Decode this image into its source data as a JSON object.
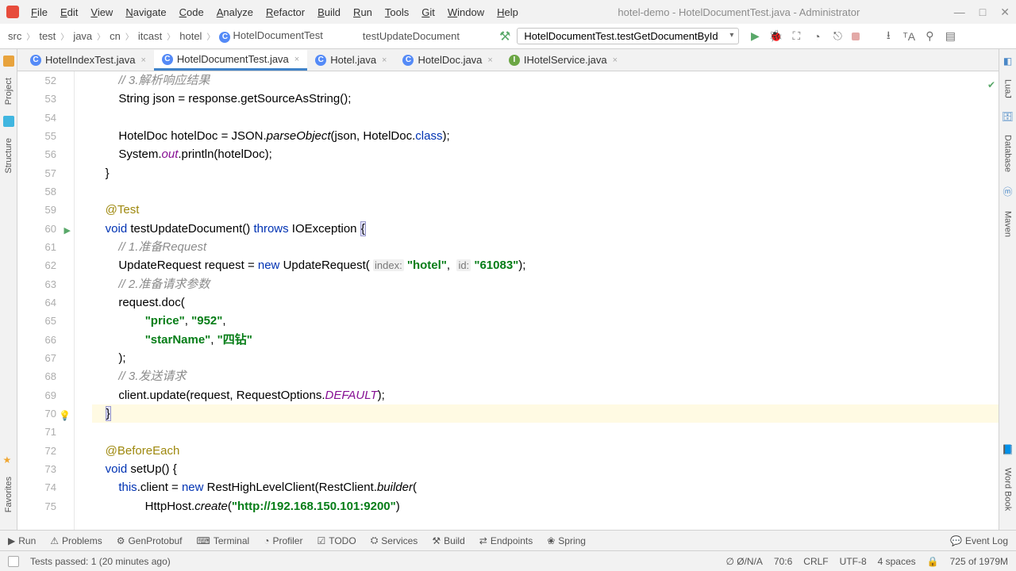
{
  "title": "hotel-demo - HotelDocumentTest.java - Administrator",
  "menu": [
    "File",
    "Edit",
    "View",
    "Navigate",
    "Code",
    "Analyze",
    "Refactor",
    "Build",
    "Run",
    "Tools",
    "Git",
    "Window",
    "Help"
  ],
  "breadcrumbs": [
    "src",
    "test",
    "java",
    "cn",
    "itcast",
    "hotel",
    "HotelDocumentTest",
    "testUpdateDocument"
  ],
  "run_config": "HotelDocumentTest.testGetDocumentById",
  "tabs": [
    {
      "icon": "c",
      "label": "HotelIndexTest.java",
      "active": false
    },
    {
      "icon": "c",
      "label": "HotelDocumentTest.java",
      "active": true
    },
    {
      "icon": "c",
      "label": "Hotel.java",
      "active": false
    },
    {
      "icon": "c",
      "label": "HotelDoc.java",
      "active": false
    },
    {
      "icon": "i",
      "label": "IHotelService.java",
      "active": false
    }
  ],
  "left_tools": [
    "Project",
    "Structure",
    "Favorites"
  ],
  "right_tools": [
    "LuaJ",
    "Database",
    "Maven",
    "Word Book"
  ],
  "bottom_tools": [
    "Run",
    "Problems",
    "GenProtobuf",
    "Terminal",
    "Profiler",
    "TODO",
    "Services",
    "Build",
    "Endpoints",
    "Spring"
  ],
  "event_log": "Event Log",
  "status": {
    "tests": "Tests passed: 1 (20 minutes ago)",
    "gc": "∅ Ø/N/A",
    "pos": "70:6",
    "eol": "CRLF",
    "enc": "UTF-8",
    "indent": "4 spaces",
    "mem": "725 of 1979M"
  },
  "gutter_start": 52,
  "code": [
    {
      "n": 52,
      "seg": [
        {
          "t": "        ",
          "c": ""
        },
        {
          "t": "// 3.解析响应结果",
          "c": "cmt"
        }
      ]
    },
    {
      "n": 53,
      "seg": [
        {
          "t": "        String json = response.getSourceAsString();",
          "c": ""
        }
      ]
    },
    {
      "n": 54,
      "seg": [
        {
          "t": "",
          "c": ""
        }
      ]
    },
    {
      "n": 55,
      "seg": [
        {
          "t": "        HotelDoc hotelDoc = JSON.",
          "c": ""
        },
        {
          "t": "parseObject",
          "c": "call"
        },
        {
          "t": "(json, HotelDoc.",
          "c": ""
        },
        {
          "t": "class",
          "c": "kw"
        },
        {
          "t": ");",
          "c": ""
        }
      ]
    },
    {
      "n": 56,
      "seg": [
        {
          "t": "        System.",
          "c": ""
        },
        {
          "t": "out",
          "c": "fld"
        },
        {
          "t": ".println(hotelDoc);",
          "c": ""
        }
      ]
    },
    {
      "n": 57,
      "seg": [
        {
          "t": "    }",
          "c": ""
        }
      ]
    },
    {
      "n": 58,
      "seg": [
        {
          "t": "",
          "c": ""
        }
      ]
    },
    {
      "n": 59,
      "seg": [
        {
          "t": "    ",
          "c": ""
        },
        {
          "t": "@Test",
          "c": "ann"
        }
      ]
    },
    {
      "n": 60,
      "run": true,
      "seg": [
        {
          "t": "    ",
          "c": ""
        },
        {
          "t": "void",
          "c": "kw"
        },
        {
          "t": " testUpdateDocument() ",
          "c": ""
        },
        {
          "t": "throws",
          "c": "kw"
        },
        {
          "t": " IOException ",
          "c": ""
        },
        {
          "t": "{",
          "c": "brace-hl"
        }
      ]
    },
    {
      "n": 61,
      "seg": [
        {
          "t": "        ",
          "c": ""
        },
        {
          "t": "// 1.准备Request",
          "c": "cmt"
        }
      ]
    },
    {
      "n": 62,
      "seg": [
        {
          "t": "        UpdateRequest request = ",
          "c": ""
        },
        {
          "t": "new",
          "c": "kw"
        },
        {
          "t": " UpdateRequest( ",
          "c": ""
        },
        {
          "t": "index:",
          "c": "hint"
        },
        {
          "t": " ",
          "c": ""
        },
        {
          "t": "\"hotel\"",
          "c": "str"
        },
        {
          "t": ",  ",
          "c": ""
        },
        {
          "t": "id:",
          "c": "hint"
        },
        {
          "t": " ",
          "c": ""
        },
        {
          "t": "\"61083\"",
          "c": "str"
        },
        {
          "t": ");",
          "c": ""
        }
      ]
    },
    {
      "n": 63,
      "seg": [
        {
          "t": "        ",
          "c": ""
        },
        {
          "t": "// 2.准备请求参数",
          "c": "cmt"
        }
      ]
    },
    {
      "n": 64,
      "seg": [
        {
          "t": "        request.doc(",
          "c": ""
        }
      ]
    },
    {
      "n": 65,
      "seg": [
        {
          "t": "                ",
          "c": ""
        },
        {
          "t": "\"price\"",
          "c": "str"
        },
        {
          "t": ", ",
          "c": ""
        },
        {
          "t": "\"952\"",
          "c": "str"
        },
        {
          "t": ",",
          "c": ""
        }
      ]
    },
    {
      "n": 66,
      "seg": [
        {
          "t": "                ",
          "c": ""
        },
        {
          "t": "\"starName\"",
          "c": "str"
        },
        {
          "t": ", ",
          "c": ""
        },
        {
          "t": "\"四钻\"",
          "c": "str"
        }
      ]
    },
    {
      "n": 67,
      "seg": [
        {
          "t": "        );",
          "c": ""
        }
      ]
    },
    {
      "n": 68,
      "seg": [
        {
          "t": "        ",
          "c": ""
        },
        {
          "t": "// 3.发送请求",
          "c": "cmt"
        }
      ]
    },
    {
      "n": 69,
      "seg": [
        {
          "t": "        client.update(request, RequestOptions.",
          "c": ""
        },
        {
          "t": "DEFAULT",
          "c": "fld"
        },
        {
          "t": ");",
          "c": ""
        }
      ]
    },
    {
      "n": 70,
      "caret": true,
      "bulb": true,
      "seg": [
        {
          "t": "    ",
          "c": ""
        },
        {
          "t": "}",
          "c": "brace-hl"
        }
      ]
    },
    {
      "n": 71,
      "seg": [
        {
          "t": "",
          "c": ""
        }
      ]
    },
    {
      "n": 72,
      "seg": [
        {
          "t": "    ",
          "c": ""
        },
        {
          "t": "@BeforeEach",
          "c": "ann"
        }
      ]
    },
    {
      "n": 73,
      "seg": [
        {
          "t": "    ",
          "c": ""
        },
        {
          "t": "void",
          "c": "kw"
        },
        {
          "t": " setUp() {",
          "c": ""
        }
      ]
    },
    {
      "n": 74,
      "seg": [
        {
          "t": "        ",
          "c": ""
        },
        {
          "t": "this",
          "c": "kw"
        },
        {
          "t": ".client = ",
          "c": ""
        },
        {
          "t": "new",
          "c": "kw"
        },
        {
          "t": " RestHighLevelClient(RestClient.",
          "c": ""
        },
        {
          "t": "builder",
          "c": "call"
        },
        {
          "t": "(",
          "c": ""
        }
      ]
    },
    {
      "n": 75,
      "seg": [
        {
          "t": "                HttpHost.",
          "c": ""
        },
        {
          "t": "create",
          "c": "call"
        },
        {
          "t": "(",
          "c": ""
        },
        {
          "t": "\"http://192.168.150.101:9200\"",
          "c": "str"
        },
        {
          "t": ")",
          "c": ""
        }
      ]
    }
  ]
}
